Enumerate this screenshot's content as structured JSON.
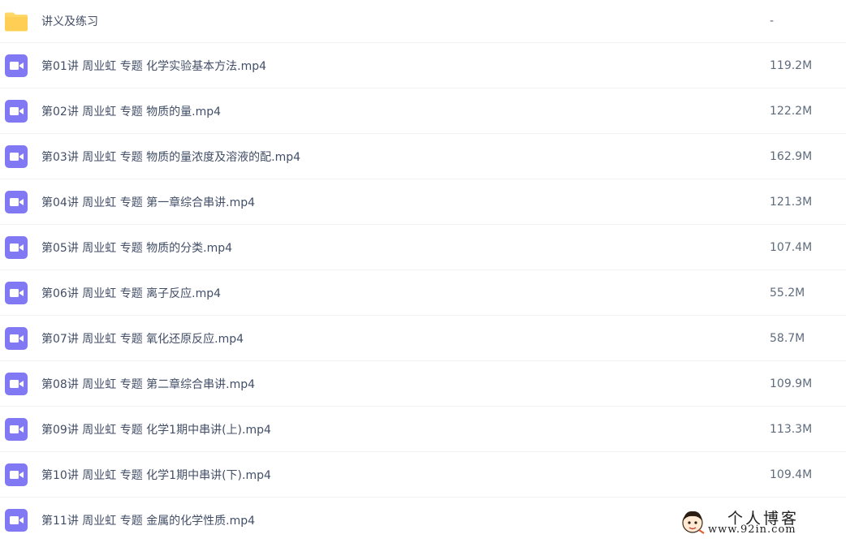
{
  "folder": {
    "name": "讲义及练习",
    "size": "-",
    "icon": "folder-icon",
    "color": "#ffd766"
  },
  "files": [
    {
      "name": "第01讲 周业虹 专题 化学实验基本方法.mp4",
      "size": "119.2M",
      "icon": "video-file-icon"
    },
    {
      "name": "第02讲 周业虹 专题 物质的量.mp4",
      "size": "122.2M",
      "icon": "video-file-icon"
    },
    {
      "name": "第03讲 周业虹 专题 物质的量浓度及溶液的配.mp4",
      "size": "162.9M",
      "icon": "video-file-icon"
    },
    {
      "name": "第04讲 周业虹 专题 第一章综合串讲.mp4",
      "size": "121.3M",
      "icon": "video-file-icon"
    },
    {
      "name": "第05讲 周业虹 专题 物质的分类.mp4",
      "size": "107.4M",
      "icon": "video-file-icon"
    },
    {
      "name": "第06讲 周业虹 专题 离子反应.mp4",
      "size": "55.2M",
      "icon": "video-file-icon"
    },
    {
      "name": "第07讲 周业虹 专题 氧化还原反应.mp4",
      "size": "58.7M",
      "icon": "video-file-icon"
    },
    {
      "name": "第08讲 周业虹 专题 第二章综合串讲.mp4",
      "size": "109.9M",
      "icon": "video-file-icon"
    },
    {
      "name": "第09讲 周业虹 专题 化学1期中串讲(上).mp4",
      "size": "113.3M",
      "icon": "video-file-icon"
    },
    {
      "name": "第10讲 周业虹 专题 化学1期中串讲(下).mp4",
      "size": "109.4M",
      "icon": "video-file-icon"
    },
    {
      "name": "第11讲 周业虹 专题 金属的化学性质.mp4",
      "size": "",
      "icon": "video-file-icon"
    }
  ],
  "video_icon_color": "#8178f4",
  "watermark": {
    "title": "个人博客",
    "url": "www.92in.com"
  }
}
